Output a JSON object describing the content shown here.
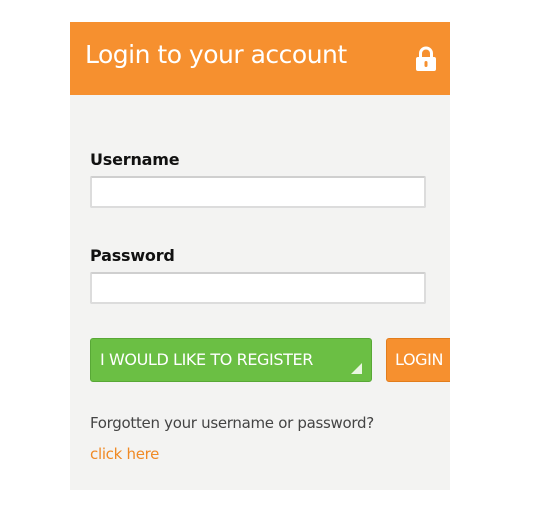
{
  "panel": {
    "title": "Login to your account",
    "header_color": "#f6902f",
    "icon": "lock-icon"
  },
  "form": {
    "username_label": "Username",
    "username_value": "",
    "password_label": "Password",
    "password_value": ""
  },
  "buttons": {
    "register_label": "I WOULD LIKE TO REGISTER",
    "register_color": "#6bbf44",
    "login_label": "LOGIN",
    "login_color": "#f6902f"
  },
  "footer": {
    "forgot_text": "Forgotten your username or password?",
    "link_text": "click here",
    "link_color": "#f08a25"
  }
}
